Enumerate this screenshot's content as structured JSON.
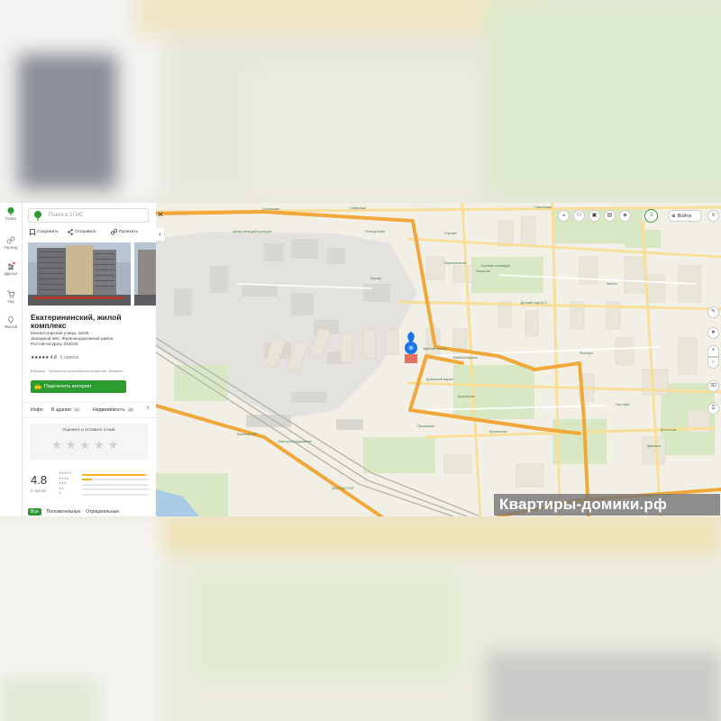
{
  "rail": {
    "items": [
      {
        "label": "Поиск",
        "icon": "tree-logo-icon"
      },
      {
        "label": "Проезд",
        "icon": "route-icon"
      },
      {
        "label": "Друзья",
        "icon": "friends-icon"
      },
      {
        "label": "Гид",
        "icon": "cart-icon"
      },
      {
        "label": "Жилой",
        "icon": "leaf-icon"
      }
    ]
  },
  "panel": {
    "search_placeholder": "Поиск в 2ГИС",
    "actions": {
      "save": "Сохранить",
      "send": "Отправить",
      "route": "Проехать"
    },
    "title": "Екатерининский, жилой комплекс",
    "address_lines": [
      "Магнитогорская улица, 1в/25",
      "Западный ж/м, Железнодорожный район,",
      "Ростов-на-Дону   344033"
    ],
    "rating": "4.8",
    "rating_count": "6 оценок",
    "ad_text": "Реклама · Публичное акционерное общество \"Вымпел...",
    "internet_button": "Подключить интернет",
    "tabs": [
      {
        "label": "Инфо"
      },
      {
        "label": "В здании",
        "count": "12"
      },
      {
        "label": "Недвижимость",
        "count": "25"
      }
    ],
    "review_prompt": "Оцените и оставьте отзыв",
    "score": "4.8",
    "score_sub": "6 оценок",
    "rating_bars": [
      0.95,
      0.15,
      0,
      0,
      0
    ],
    "filters": {
      "all": "Все",
      "positive": "Положительные",
      "negative": "Отрицательные"
    }
  },
  "map": {
    "login": "Войти",
    "counter": "3",
    "zoom_in": "+",
    "zoom_out": "−",
    "view3d": "3D",
    "labels": [
      "Петровская",
      "Северская",
      "Пластикаус",
      "Торговая площадка",
      "Детский сад №74",
      "Полоцк Кафе",
      "Центр немецкой культуры",
      "Мастер",
      "Магнит",
      "Удобная Аптека",
      "Домашний маркет",
      "Кутаисская",
      "Пестовская",
      "Закрытая",
      "Маргинальная",
      "Комплект ЮГ",
      "Электрооборудование",
      "Магнитогорская",
      "КАСТРАСТ-ЮГ",
      "Спутник",
      "Кружевская",
      "Фостеры",
      "Про Кайо",
      "Дешевое",
      "Восточная"
    ]
  },
  "watermark": "Квартиры-домики.рф",
  "colors": {
    "brand_green": "#2b9a2f",
    "route_orange": "#f0a83a",
    "road_yellow": "#f7df9a",
    "marker_blue": "#1a73e8",
    "map_bg": "#f1efe6"
  }
}
